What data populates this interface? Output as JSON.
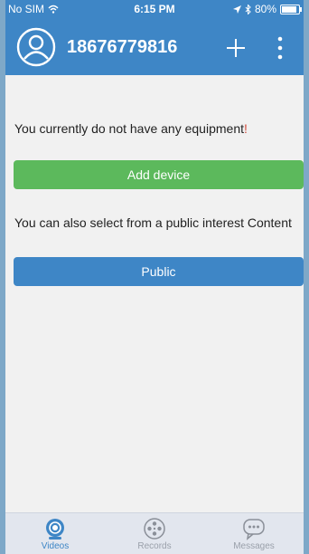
{
  "status": {
    "carrier": "No SIM",
    "time": "6:15 PM",
    "battery": "80%",
    "battery_level": 0.8
  },
  "header": {
    "phone_number": "18676779816",
    "icons": [
      "avatar-icon",
      "plus-icon",
      "more-icon"
    ]
  },
  "main": {
    "empty_text": "You currently do not have any equipment",
    "empty_mark": "!",
    "add_device_label": "Add device",
    "public_text": "You can also select from a public interest Content",
    "public_label": "Public"
  },
  "tabs": [
    {
      "label": "Videos",
      "icon": "camera-icon",
      "active": true
    },
    {
      "label": "Records",
      "icon": "film-reel-icon",
      "active": false
    },
    {
      "label": "Messages",
      "icon": "chat-bubble-icon",
      "active": false
    }
  ],
  "colors": {
    "primary": "#3e86c6",
    "success": "#5cb95c",
    "background": "#f1f1f1",
    "tab_inactive": "#9aa0aa"
  }
}
